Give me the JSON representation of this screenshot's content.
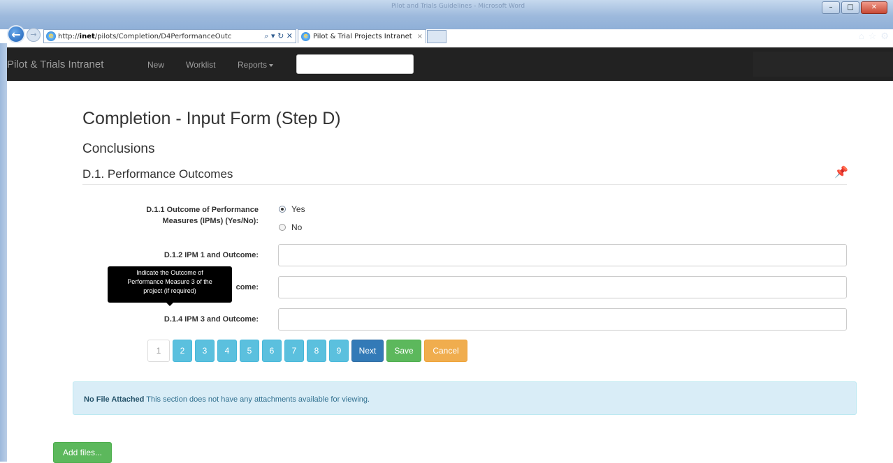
{
  "browser": {
    "title": "Pilot and Trials Guidelines - Microsoft Word",
    "url_prefix": "http://",
    "url_host": "inet",
    "url_path": "/pilots/Completion/D4PerformanceOutc",
    "url_tools": "⌕ ▾ ↻ ✕",
    "tab_title": "Pilot & Trial Projects Intranet",
    "tab_close": "×",
    "back_glyph": "←",
    "forward_glyph": "→",
    "window_buttons": [
      "–",
      "□",
      "✕"
    ],
    "right_icons": [
      "⌂",
      "☆",
      "⚙"
    ]
  },
  "navbar": {
    "brand": "Pilot & Trials Intranet",
    "new": "New",
    "worklist": "Worklist",
    "reports": "Reports",
    "search_value": ""
  },
  "page": {
    "title": "Completion - Input Form (Step D)",
    "section": "Conclusions",
    "subsection": "D.1. Performance Outcomes",
    "pin_icon": "📌"
  },
  "form": {
    "q1_label_line1": "D.1.1 Outcome of Performance",
    "q1_label_line2": "Measures (IPMs) (Yes/No):",
    "q1_option_yes": "Yes",
    "q1_option_no": "No",
    "q1_selected": "Yes",
    "q2_label": "D.1.2 IPM 1 and Outcome:",
    "q2_value": "",
    "q3_label_visible": "come:",
    "q3_value": "",
    "q4_label": "D.1.4 IPM 3 and Outcome:",
    "q4_value": ""
  },
  "tooltip": {
    "line1": "Indicate the Outcome of",
    "line2": "Performance Measure 3 of the",
    "line3": "project (if required)"
  },
  "pager": {
    "pages": [
      "1",
      "2",
      "3",
      "4",
      "5",
      "6",
      "7",
      "8",
      "9"
    ],
    "current": "1",
    "next": "Next",
    "save": "Save",
    "cancel": "Cancel"
  },
  "alert": {
    "strong": "No File Attached",
    "text": " This section does not have any attachments available for viewing."
  },
  "add_files": "Add files...",
  "colors": {
    "navbar_bg": "#222222",
    "info": "#5bc0de",
    "primary": "#337ab7",
    "success": "#5cb85c",
    "warning": "#f0ad4e",
    "alert_bg": "#d9edf7"
  }
}
